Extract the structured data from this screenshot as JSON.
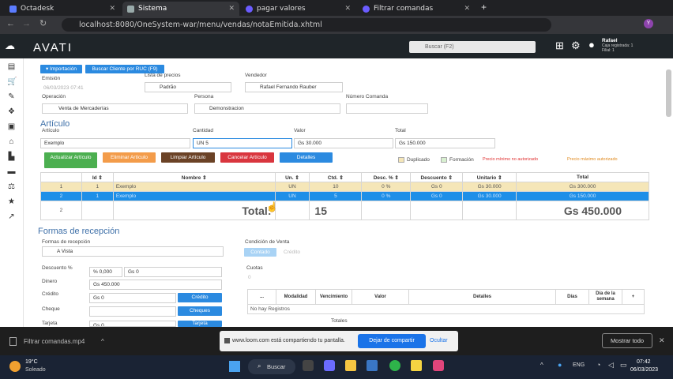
{
  "browser": {
    "tabs": [
      {
        "label": "Octadesk"
      },
      {
        "label": "Sistema"
      },
      {
        "label": "pagar valores"
      },
      {
        "label": "Filtrar comandas"
      }
    ],
    "url": "localhost:8080/OneSystem-war/menu/vendas/notaEmitida.xhtml"
  },
  "app": {
    "logo": "AVATI",
    "search_placeholder": "Buscar (F2)",
    "user": {
      "name": "Rafael",
      "line1": "Caja registrada: 1",
      "line2": "Filial: 1",
      "avatar": "Y"
    }
  },
  "header_buttons": {
    "import": "▾ Importación",
    "search_client": "Buscar Cliente por RUC (F9)"
  },
  "fields": {
    "emision_label": "Emisión",
    "emision_value": "06/03/2023 07:41",
    "lista_label": "Lista de precios",
    "lista_value": "Padrão",
    "vendedor_label": "Vendedor",
    "vendedor_value": "Rafael Fernando Rauber",
    "operacion_label": "Operación",
    "operacion_value": "Venta de Mercaderías",
    "persona_label": "Persona",
    "persona_value": "Demonstracion",
    "comanda_label": "Número Comanda",
    "comanda_value": ""
  },
  "articulo": {
    "section_title": "Artículo",
    "articulo_label": "Artículo",
    "articulo_value": "Exemplo",
    "cantidad_label": "Cantidad",
    "cantidad_value": "UN 5",
    "valor_label": "Valor",
    "valor_value": "Gs 30.000",
    "total_label": "Total",
    "total_value": "Gs 150.000"
  },
  "actions": {
    "update": "Actualizar Artículo",
    "delete": "Eliminar Artículo",
    "clear": "Limpiar Artículo",
    "cancel": "Cancelar Artículo",
    "details": "Detalles",
    "duplicado": "Duplicado",
    "formacion": "Formación",
    "precio_min": "Precio mínimo no autorizado",
    "precio_max": "Precio máximo autorizado"
  },
  "grid": {
    "headers": [
      "Id ⇕",
      "Nombre ⇕",
      "Un. ⇕",
      "Ctd. ⇕",
      "Desc. % ⇕",
      "Descuento ⇕",
      "Unitario ⇕",
      "Total"
    ],
    "rows": [
      [
        "1",
        "1",
        "Exemplo",
        "UN",
        "10",
        "0 %",
        "Gs 0",
        "Gs 30.000",
        "Gs 300.000"
      ],
      [
        "2",
        "1",
        "Exemplo",
        "UN",
        "5",
        "0 %",
        "Gs 0",
        "Gs 30.000",
        "Gs 150.000"
      ]
    ],
    "footer_index": "2",
    "total_label": "Total:",
    "total_qty": "15",
    "total_value": "Gs 450.000"
  },
  "recepcion": {
    "title": "Formas de recepción",
    "formas_label": "Formas de recepción",
    "formas_value": "A Vista",
    "descuento_label": "Descuento %",
    "descuento_pct": "% 0,000",
    "descuento_gs": "Gs 0",
    "dinero_label": "Dinero",
    "dinero_value": "Gs 450.000",
    "credito_label": "Crédito",
    "credito_value": "Gs 0",
    "credito_btn": "Crédito",
    "cheque_label": "Cheque",
    "cheque_btn": "Cheques",
    "tarjeta_label": "Tarjeta",
    "tarjeta_value": "Gs 0",
    "tarjeta_btn": "Tarjeta"
  },
  "condicion": {
    "label": "Condición de Venta",
    "contado": "Contado",
    "credito": "Crédito",
    "cuotas_label": "Cuotas",
    "cuotas_value": "0",
    "headers": [
      "...",
      "Modalidad",
      "Vencimiento",
      "Valor",
      "Detalles",
      "Días",
      "Día de la semana",
      "+"
    ],
    "empty": "No hay Registros",
    "totales": "Totales"
  },
  "loom": {
    "file": "Filtrar comandas.mp4",
    "share_text": "www.loom.com está compartiendo tu pantalla.",
    "stop": "Dejar de compartir",
    "hide": "Ocultar",
    "show_all": "Mostrar todo"
  },
  "taskbar": {
    "temp": "19°C",
    "weather": "Soleado",
    "search": "Buscar",
    "lang": "ENG",
    "time": "07:42",
    "date": "06/03/2023"
  }
}
